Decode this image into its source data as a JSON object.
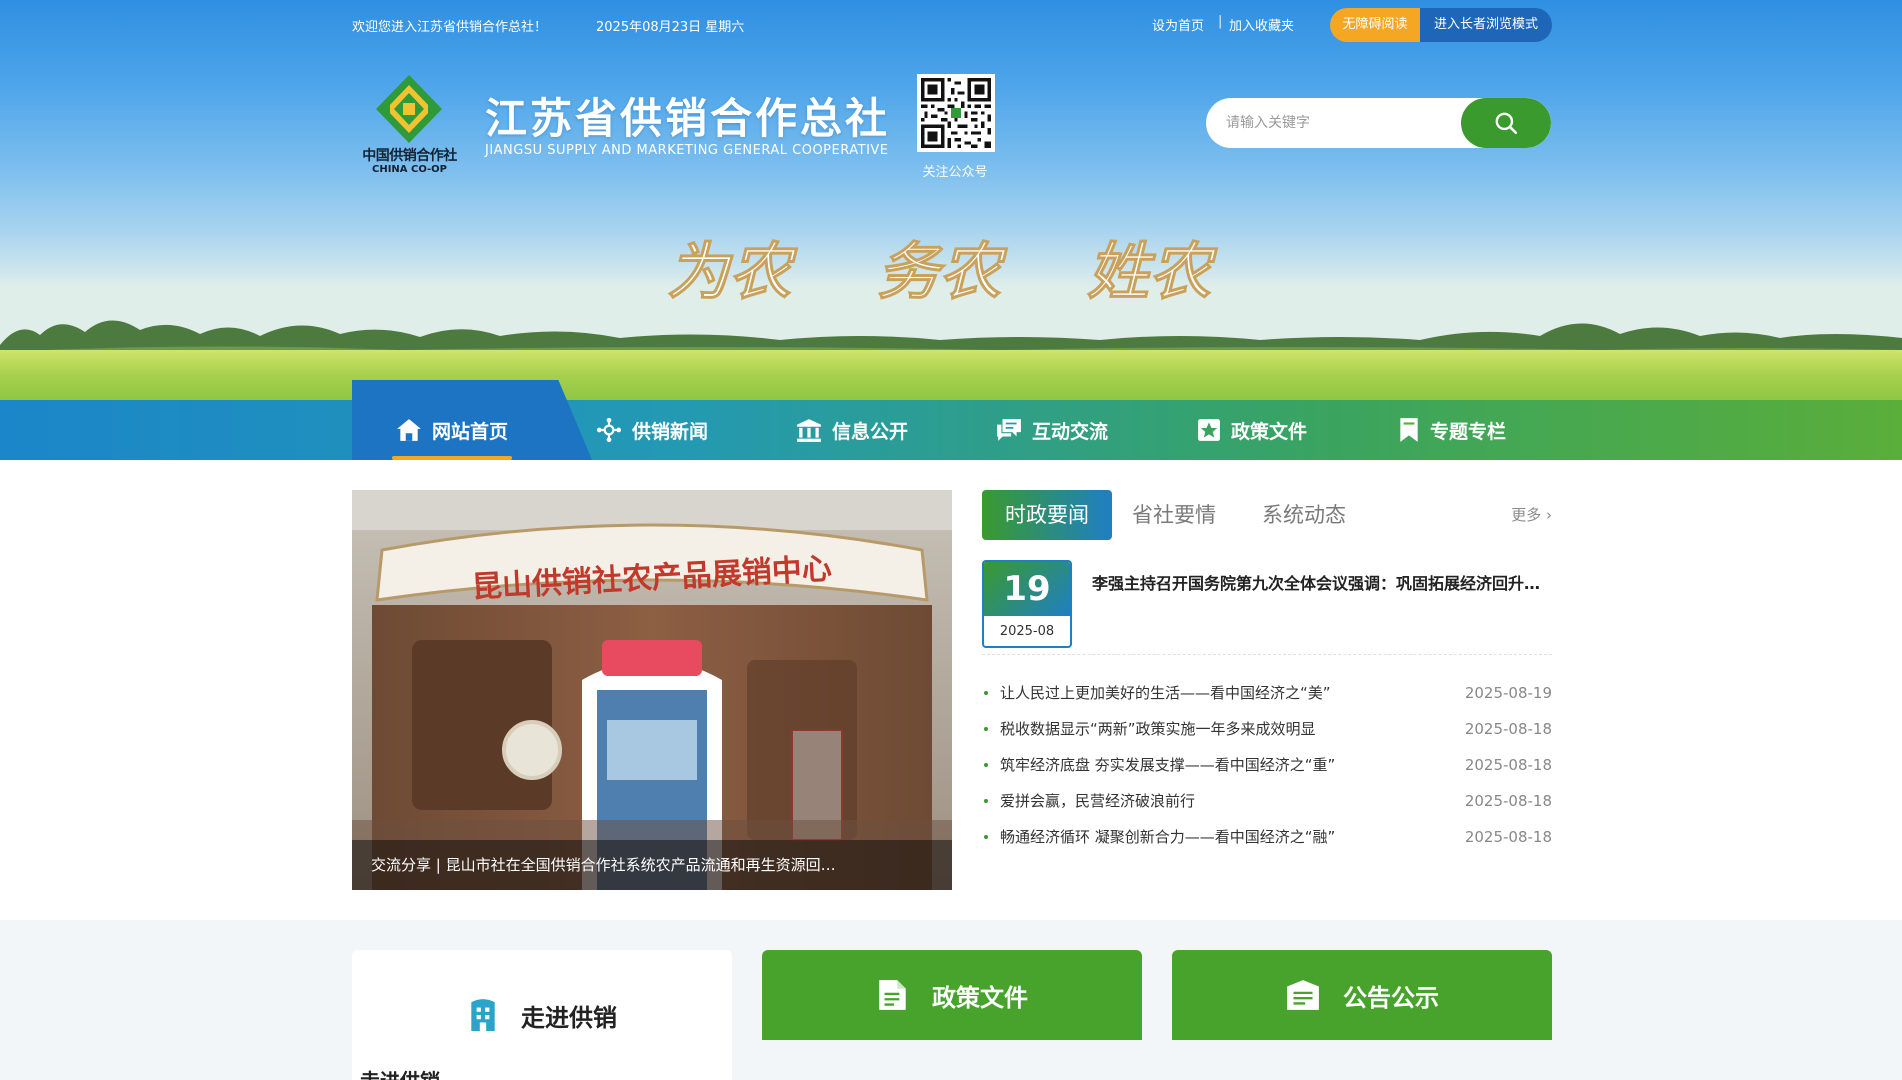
{
  "topbar": {
    "welcome": "欢迎您进入江苏省供销合作总社！",
    "date": "2025年08月23日 星期六",
    "set_home": "设为首页",
    "separator": "|",
    "add_favorite": "加入收藏夹",
    "accessible": "无障碍阅读",
    "elder_mode": "进入长者浏览模式"
  },
  "header": {
    "logo_cn": "中国供销合作社",
    "logo_en": "CHINA CO-OP",
    "title": "江苏省供销合作总社",
    "subtitle": "JIANGSU SUPPLY AND MARKETING GENERAL COOPERATIVE",
    "qr_label": "关注公众号",
    "slogan": [
      "为农",
      "务农",
      "姓农"
    ]
  },
  "search": {
    "placeholder": "请输入关键字"
  },
  "nav": {
    "items": [
      {
        "label": "网站首页",
        "icon": "home-icon"
      },
      {
        "label": "供销新闻",
        "icon": "network-icon"
      },
      {
        "label": "信息公开",
        "icon": "building-icon"
      },
      {
        "label": "互动交流",
        "icon": "chat-icon"
      },
      {
        "label": "政策文件",
        "icon": "star-document-icon"
      },
      {
        "label": "专题专栏",
        "icon": "bookmark-icon"
      }
    ]
  },
  "slider": {
    "caption": "交流分享 | 昆山市社在全国供销合作社系统农产品流通和再生资源回收利用工作会议上交流发言",
    "sign_text": "昆山供销社农产品展销中心",
    "dots": 5,
    "active_dot": 4
  },
  "news": {
    "tabs": [
      "时政要闻",
      "省社要情",
      "系统动态"
    ],
    "more": "更多",
    "headline": {
      "day": "19",
      "year_month": "2025-08",
      "title": "李强主持召开国务院第九次全体会议强调：巩固拓展经济回升向好势头"
    },
    "items": [
      {
        "title": "让人民过上更加美好的生活——看中国经济之“美”",
        "date": "2025-08-19"
      },
      {
        "title": "税收数据显示“两新”政策实施一年多来成效明显",
        "date": "2025-08-18"
      },
      {
        "title": "筑牢经济底盘 夯实发展支撑——看中国经济之“重”",
        "date": "2025-08-18"
      },
      {
        "title": "爱拼会赢，民营经济破浪前行",
        "date": "2025-08-18"
      },
      {
        "title": "畅通经济循环 凝聚创新合力——看中国经济之“融”",
        "date": "2025-08-18"
      }
    ]
  },
  "cards": [
    {
      "label": "走进供销",
      "icon": "building-icon"
    },
    {
      "label": "政策文件",
      "icon": "document-icon"
    },
    {
      "label": "公告公示",
      "icon": "notice-icon"
    }
  ],
  "section": {
    "heading": "走进供销"
  },
  "colors": {
    "green": "#3a9a2e",
    "blue": "#1f7fc4",
    "orange": "#f5a623",
    "nav_start": "#1b86c9",
    "nav_end": "#5aae3a"
  }
}
